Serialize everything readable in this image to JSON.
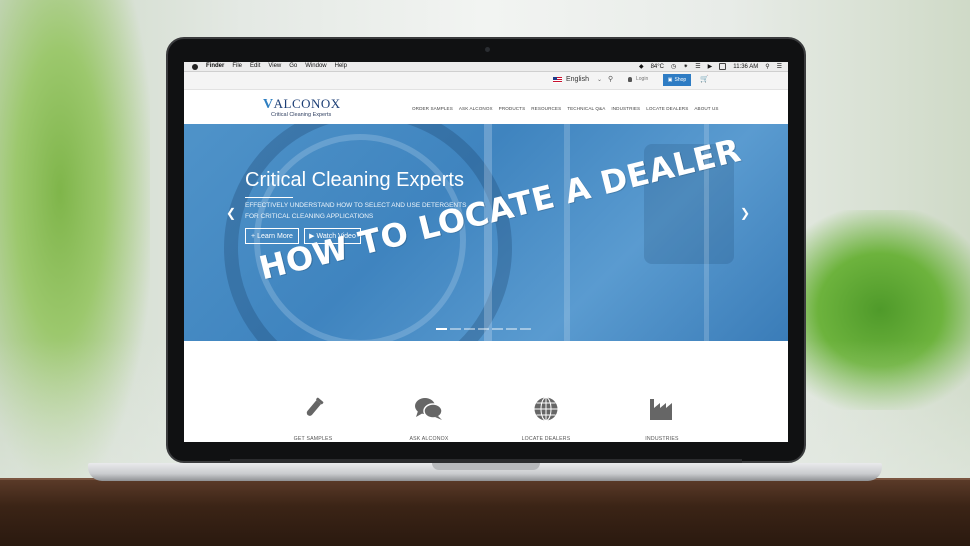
{
  "menubar": {
    "app": "Finder",
    "items": [
      "File",
      "Edit",
      "View",
      "Go",
      "Window",
      "Help"
    ],
    "temperature": "84°C",
    "time": "11:36 AM"
  },
  "topbar": {
    "language": "English",
    "login_label": "Login",
    "shop_label": "Shop"
  },
  "header": {
    "logo_text": "ALCONOX",
    "logo_letter": "V",
    "logo_tagline": "Critical Cleaning Experts",
    "nav": [
      "ORDER SAMPLES",
      "ASK ALCONOX",
      "PRODUCTS",
      "RESOURCES",
      "TECHNICAL Q&A",
      "INDUSTRIES",
      "LOCATE DEALERS",
      "ABOUT US"
    ]
  },
  "hero": {
    "title": "Critical Cleaning Experts",
    "subtitle_line1": "EFFECTIVELY UNDERSTAND HOW TO SELECT AND USE DETERGENTS",
    "subtitle_line2": "FOR CRITICAL CLEANING APPLICATIONS",
    "learn_more": "Learn More",
    "watch_video": "Watch Video",
    "overlay_text": "HOW TO LOCATE A DEALER",
    "slide_count": 7,
    "active_slide": 1
  },
  "features": [
    {
      "label": "GET SAMPLES",
      "icon": "test-tube-icon"
    },
    {
      "label": "ASK ALCONOX",
      "icon": "chat-bubbles-icon"
    },
    {
      "label": "LOCATE DEALERS",
      "icon": "globe-icon"
    },
    {
      "label": "INDUSTRIES",
      "icon": "factory-icon"
    }
  ],
  "colors": {
    "brand_blue": "#2f7fc1",
    "logo_navy": "#1d3f76",
    "hero_blue": "#4a8fc7",
    "shop_button": "#2e7cc4"
  }
}
